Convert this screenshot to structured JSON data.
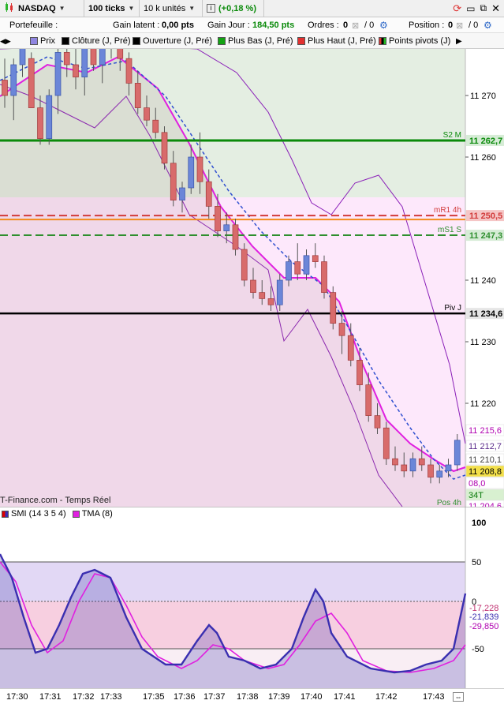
{
  "toolbar": {
    "instrument": "NASDAQ",
    "ticks": "100 ticks",
    "units": "10 k unités",
    "change": "(+0,18 %)",
    "info_icon": "i"
  },
  "portfolio": {
    "label": "Portefeuille :",
    "unrealized_label": "Gain latent :",
    "unrealized_value": "0,00 pts",
    "day_label": "Gain Jour :",
    "day_value": "184,50 pts",
    "orders_label": "Ordres :",
    "orders_value": "0",
    "orders_count": "/ 0",
    "position_label": "Position :",
    "position_value": "0",
    "position_count": "/ 0"
  },
  "legend": {
    "items": [
      {
        "label": "Prix",
        "color": "#7b6fd6"
      },
      {
        "label": "Clôture (J, Pré)",
        "color": "#000000"
      },
      {
        "label": "Ouverture (J, Pré)",
        "color": "#000000"
      },
      {
        "label": "Plus Bas (J, Pré)",
        "color": "#13a313"
      },
      {
        "label": "Plus Haut (J, Pré)",
        "color": "#e23030"
      },
      {
        "label": "Points pivots (J)",
        "color": "#000000"
      }
    ]
  },
  "levels": {
    "s2m": {
      "label": "S2 M",
      "price": "11 262,7",
      "value": 11262.7,
      "color": "#0a8a0a"
    },
    "mr1": {
      "label": "mR1 4h",
      "price": "11 250,5",
      "value": 11250.5,
      "color": "#d23b3b"
    },
    "ms1": {
      "label": "mS1 S",
      "price": "11 247,3",
      "value": 11247.3,
      "color": "#2f8f2f"
    },
    "piv": {
      "label": "Piv J",
      "price": "11 234,6",
      "value": 11234.6,
      "color": "#000000"
    },
    "pos": {
      "label": "Pos 4h"
    }
  },
  "price_axis": {
    "ticks": [
      "11 270",
      "11 260",
      "11 240",
      "11 230",
      "11 220"
    ],
    "tags": [
      {
        "text": "11 215,6",
        "color": "#b000b0",
        "value": 11215.6
      },
      {
        "text": "11 212,7",
        "color": "#5a2a8a",
        "value": 11212.7
      },
      {
        "text": "11 210,1",
        "color": "#444444",
        "value": 11210.1
      },
      {
        "text": "11 208,8",
        "color": "#000000",
        "value": 11208.8
      },
      {
        "text": "08,0",
        "color": "#b000b0",
        "value": 11208.0
      },
      {
        "text": "34T",
        "color": "#0a7a0a",
        "value": 11206.4
      },
      {
        "text": "11 204,6",
        "color": "#b000b0",
        "value": 11204.6
      }
    ]
  },
  "source_label": "T-Finance.com - Temps Réel",
  "oscillator": {
    "legend": [
      {
        "label": "SMI (14 3 5 4)",
        "color": "#3a2fb0"
      },
      {
        "label": "TMA (8)",
        "color": "#e020e0"
      }
    ],
    "axis": [
      "100",
      "50",
      "0",
      "-50"
    ],
    "tags": [
      {
        "text": "-17,228",
        "color": "#c03070"
      },
      {
        "text": "-21,839",
        "color": "#3a2fb0"
      },
      {
        "text": "-29,850",
        "color": "#b000b0"
      }
    ]
  },
  "xaxis": [
    "17:30",
    "17:31",
    "17:32",
    "17:33",
    "17:35",
    "17:36",
    "17:37",
    "17:38",
    "17:39",
    "17:40",
    "17:41",
    "17:42",
    "17:43"
  ],
  "chart_data": {
    "type": "candlestick",
    "series_candles": [
      [
        11272.5,
        11276,
        11268,
        11270
      ],
      [
        11270,
        11276,
        11266,
        11275
      ],
      [
        11275,
        11280,
        11273,
        11278
      ],
      [
        11276,
        11277,
        11268,
        11268
      ],
      [
        11268,
        11270,
        11262,
        11263
      ],
      [
        11263,
        11271,
        11262,
        11270
      ],
      [
        11270,
        11279,
        11267,
        11277
      ],
      [
        11277,
        11280,
        11273,
        11275
      ],
      [
        11275,
        11278,
        11271,
        11273
      ],
      [
        11273,
        11279,
        11270,
        11278
      ],
      [
        11278,
        11281,
        11274,
        11275
      ],
      [
        11275,
        11280,
        11272,
        11278
      ],
      [
        11278,
        11281,
        11276,
        11279
      ],
      [
        11279,
        11281,
        11274,
        11276
      ],
      [
        11276,
        11277,
        11270,
        11272
      ],
      [
        11272,
        11274,
        11267,
        11268
      ],
      [
        11268,
        11270,
        11265,
        11266
      ],
      [
        11266,
        11268,
        11263,
        11264
      ],
      [
        11264,
        11265,
        11258,
        11259
      ],
      [
        11259,
        11261,
        11252,
        11253
      ],
      [
        11253,
        11256,
        11251,
        11255
      ],
      [
        11255,
        11262,
        11254,
        11260
      ],
      [
        11260,
        11264,
        11254,
        11256
      ],
      [
        11256,
        11258,
        11250,
        11252
      ],
      [
        11252,
        11254,
        11247,
        11248
      ],
      [
        11248,
        11251,
        11246,
        11249
      ],
      [
        11249,
        11250,
        11244,
        11245
      ],
      [
        11245,
        11246,
        11239,
        11240
      ],
      [
        11240,
        11242,
        11237,
        11238
      ],
      [
        11238,
        11240,
        11236,
        11237
      ],
      [
        11237,
        11239,
        11235,
        11236
      ],
      [
        11236,
        11241,
        11235,
        11240
      ],
      [
        11240,
        11244,
        11239,
        11243
      ],
      [
        11243,
        11246,
        11240,
        11241
      ],
      [
        11241,
        11245,
        11240,
        11244
      ],
      [
        11244,
        11246,
        11242,
        11243
      ],
      [
        11243,
        11244,
        11237,
        11238
      ],
      [
        11238,
        11239,
        11232,
        11233
      ],
      [
        11233,
        11235,
        11228,
        11231
      ],
      [
        11231,
        11233,
        11226,
        11227
      ],
      [
        11227,
        11229,
        11222,
        11223
      ],
      [
        11223,
        11225,
        11217,
        11218
      ],
      [
        11218,
        11220,
        11215,
        11216
      ],
      [
        11216,
        11217,
        11210,
        11211
      ],
      [
        11211,
        11213,
        11209,
        11210
      ],
      [
        11210,
        11212,
        11208,
        11209
      ],
      [
        11209,
        11212,
        11208,
        11211
      ],
      [
        11211,
        11213,
        11209,
        11210
      ],
      [
        11210,
        11211,
        11207,
        11208
      ],
      [
        11208,
        11210,
        11207,
        11209
      ],
      [
        11209,
        11211,
        11208,
        11210
      ],
      [
        11210,
        11215,
        11209,
        11214
      ]
    ]
  }
}
